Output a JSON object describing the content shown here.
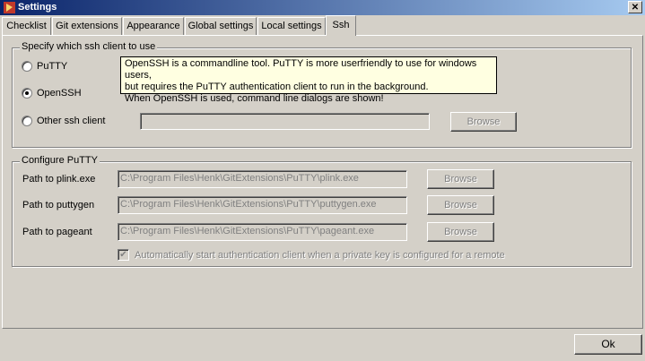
{
  "window": {
    "title": "Settings",
    "close_glyph": "✕"
  },
  "tabs": [
    {
      "label": "Checklist"
    },
    {
      "label": "Git extensions"
    },
    {
      "label": "Appearance"
    },
    {
      "label": "Global settings"
    },
    {
      "label": "Local settings"
    },
    {
      "label": "Ssh"
    }
  ],
  "active_tab": "Ssh",
  "ssh_client_group": {
    "legend": "Specify which ssh client to use",
    "options": [
      {
        "label": "PuTTY",
        "selected": false
      },
      {
        "label": "OpenSSH",
        "selected": true
      },
      {
        "label": "Other ssh client",
        "selected": false
      }
    ],
    "other_path_value": "",
    "browse_label": "Browse"
  },
  "tooltip": {
    "line1": "OpenSSH is a commandline tool. PuTTY is more userfriendly to use for windows users,",
    "line2": "but requires the PuTTY authentication client to run  in the background.",
    "line3": "When OpenSSH is used, command line dialogs are shown!"
  },
  "putty_group": {
    "legend": "Configure PuTTY",
    "rows": [
      {
        "label": "Path to plink.exe",
        "value": "C:\\Program Files\\Henk\\GitExtensions\\PuTTY\\plink.exe",
        "browse_label": "Browse"
      },
      {
        "label": "Path to puttygen",
        "value": "C:\\Program Files\\Henk\\GitExtensions\\PuTTY\\puttygen.exe",
        "browse_label": "Browse"
      },
      {
        "label": "Path to pageant",
        "value": "C:\\Program Files\\Henk\\GitExtensions\\PuTTY\\pageant.exe",
        "browse_label": "Browse"
      }
    ],
    "auto_start_checked": true,
    "auto_start_label": "Automatically start authentication client when a private key is configured for a remote"
  },
  "ok_label": "Ok",
  "colors": {
    "face": "#d4d0c8",
    "titlebar_start": "#0a246a",
    "titlebar_end": "#a6caf0",
    "tooltip_bg": "#ffffe1",
    "disabled_text": "#808080"
  }
}
